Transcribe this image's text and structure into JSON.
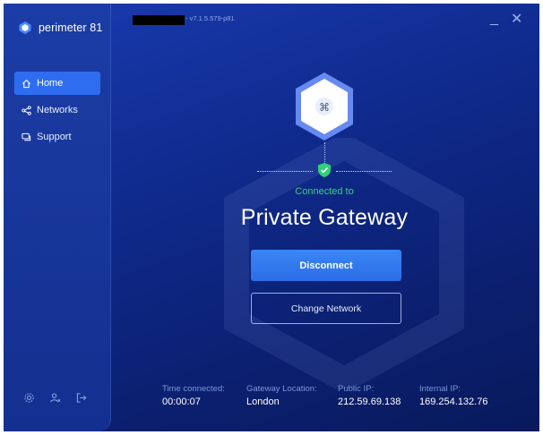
{
  "app": {
    "brand_name": "perimeter 81",
    "version": "- v7.1.5.579-p81"
  },
  "window_controls": {
    "minimize_glyph": "_",
    "close_glyph": "✕"
  },
  "sidebar": {
    "items": [
      {
        "label": "Home",
        "icon": "home-icon",
        "active": true
      },
      {
        "label": "Networks",
        "icon": "share-icon",
        "active": false
      },
      {
        "label": "Support",
        "icon": "chat-icon",
        "active": false
      }
    ],
    "bottom_icons": [
      "settings-icon",
      "user-icon",
      "logout-icon"
    ]
  },
  "status": {
    "connected_label": "Connected to",
    "gateway_name": "Private Gateway"
  },
  "actions": {
    "disconnect_label": "Disconnect",
    "change_network_label": "Change Network"
  },
  "stats": [
    {
      "label": "Time connected:",
      "value": "00:00:07"
    },
    {
      "label": "Gateway Location:",
      "value": "London"
    },
    {
      "label": "Public IP:",
      "value": "212.59.69.138"
    },
    {
      "label": "Internal IP:",
      "value": "169.254.132.76"
    }
  ],
  "colors": {
    "accent": "#2f6df0",
    "connected_green": "#36d17a",
    "background": "#0f2a8c"
  }
}
